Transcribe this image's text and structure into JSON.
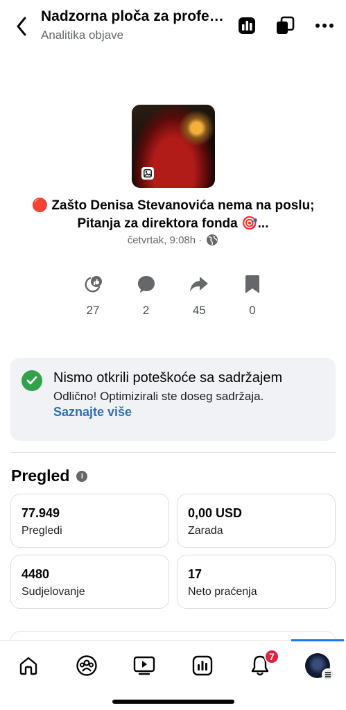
{
  "header": {
    "title": "Nadzorna ploča za profesionalce",
    "subtitle": "Analitika objave"
  },
  "post": {
    "title_line1": "🔴 Zašto Denisa Stevanovića nema na poslu;",
    "title_line2": "Pitanja za direktora fonda 🎯...",
    "meta": "četvrtak, 9:08h ·"
  },
  "stats": [
    {
      "icon": "reactions-icon",
      "value": "27"
    },
    {
      "icon": "comment-icon",
      "value": "2"
    },
    {
      "icon": "share-icon",
      "value": "45"
    },
    {
      "icon": "bookmark-icon",
      "value": "0"
    }
  ],
  "info_card": {
    "title": "Nismo otkrili poteškoće sa sadržajem",
    "text": "Odlično! Optimizirali ste doseg sadržaja.",
    "link": "Saznajte više"
  },
  "overview": {
    "title": "Pregled",
    "tiles": [
      {
        "value": "77.949",
        "label": "Pregledi"
      },
      {
        "value": "0,00 USD",
        "label": "Zarada"
      },
      {
        "value": "4480",
        "label": "Sudjelovanje"
      },
      {
        "value": "17",
        "label": "Neto praćenja"
      }
    ]
  },
  "bottom_nav": {
    "notification_count": "7",
    "items": [
      "home-icon",
      "groups-icon",
      "video-icon",
      "dashboard-icon",
      "notifications-icon",
      "profile-avatar"
    ]
  },
  "colors": {
    "accent": "#1877f2",
    "link": "#2d6fb6",
    "success": "#31a24c",
    "badge": "#e41e3f"
  }
}
